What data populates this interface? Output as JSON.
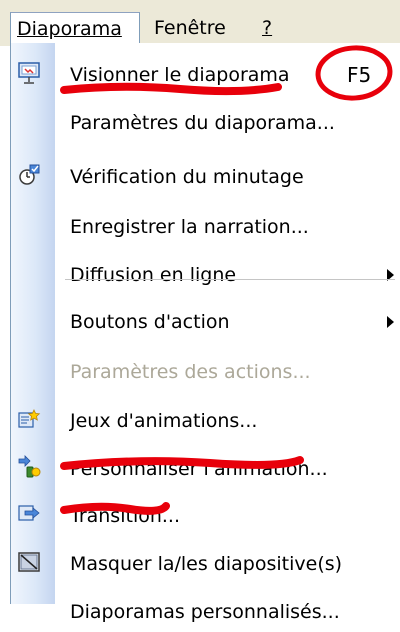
{
  "menubar": {
    "items": [
      {
        "label": "Diaporama",
        "open": true
      },
      {
        "label": "Fenêtre"
      },
      {
        "label": "?"
      }
    ]
  },
  "dropdown": {
    "items": [
      {
        "label": "Visionner le diaporama",
        "shortcut": "F5",
        "icon": "slideshow-icon"
      },
      {
        "label": "Paramètres du diaporama..."
      },
      {
        "label": "Vérification du minutage",
        "icon": "timing-check-icon"
      },
      {
        "label": "Enregistrer la narration..."
      },
      {
        "label": "Diffusion en ligne",
        "submenu": true
      },
      {
        "label": "Boutons d'action",
        "submenu": true
      },
      {
        "label": "Paramètres des actions...",
        "disabled": true
      },
      {
        "label": "Jeux d'animations...",
        "icon": "animation-schemes-icon"
      },
      {
        "label": "Personnaliser l'animation...",
        "icon": "custom-animation-icon"
      },
      {
        "label": "Transition...",
        "icon": "transition-icon"
      },
      {
        "label": "Masquer la/les diapositive(s)",
        "icon": "hide-slide-icon"
      },
      {
        "label": "Diaporamas personnalisés..."
      }
    ]
  },
  "colors": {
    "annotation": "#e8000b",
    "menubar_bg": "#ece9d8",
    "disabled_text": "#aca899"
  }
}
